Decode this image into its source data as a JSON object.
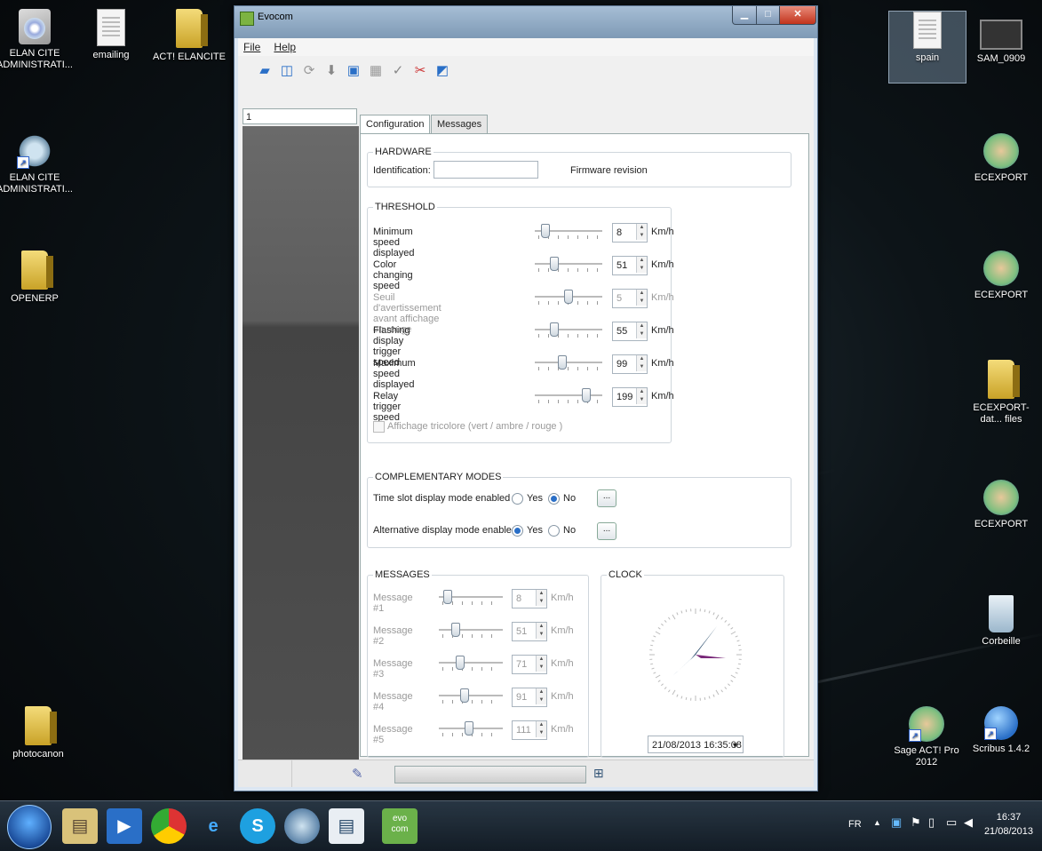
{
  "desktop": {
    "left_icons": [
      {
        "label": "ELAN CITE ADMINISTRATI...",
        "icon": "cd-icon"
      },
      {
        "label": "emailing",
        "icon": "document-icon"
      },
      {
        "label": "ACT! ELANCITE",
        "icon": "folder-icon"
      },
      {
        "label": "ELAN CITE ADMINISTRATI...",
        "icon": "gear-icon"
      },
      {
        "label": "OPENERP",
        "icon": "folder-icon"
      },
      {
        "label": "photocanon",
        "icon": "folder-icon"
      }
    ],
    "right_icons": [
      {
        "label": "spain",
        "icon": "document-icon"
      },
      {
        "label": "SAM_0909",
        "icon": "camera-icon"
      },
      {
        "label": "ECEXPORT",
        "icon": "handshake-icon"
      },
      {
        "label": "ECEXPORT",
        "icon": "handshake-icon"
      },
      {
        "label": "ECEXPORT-dat... files",
        "icon": "folder-icon"
      },
      {
        "label": "ECEXPORT",
        "icon": "handshake-icon"
      },
      {
        "label": "Corbeille",
        "icon": "recycle-bin-icon"
      },
      {
        "label": "Sage ACT! Pro 2012",
        "icon": "handshake-icon"
      },
      {
        "label": "Scribus 1.4.2",
        "icon": "scribus-icon"
      }
    ]
  },
  "window": {
    "title": "Evocom",
    "menu": [
      "File",
      "Help"
    ],
    "left_input_value": "1",
    "tabs": [
      "Configuration",
      "Messages"
    ],
    "hardware": {
      "legend": "HARDWARE",
      "identification_label": "Identification:",
      "identification_value": "",
      "firmware_label": "Firmware revision"
    },
    "threshold": {
      "legend": "THRESHOLD",
      "rows": [
        {
          "label": "Minimum speed displayed",
          "value": "8",
          "unit": "Km/h",
          "level": 0.1,
          "enabled": true
        },
        {
          "label": "Color changing speed",
          "value": "51",
          "unit": "Km/h",
          "level": 0.25,
          "enabled": true
        },
        {
          "label": "Seuil d'avertissement avant affichage en rouge",
          "value": "5",
          "unit": "Km/h",
          "level": 0.5,
          "enabled": false
        },
        {
          "label": "Flashing display trigger speed",
          "value": "55",
          "unit": "Km/h",
          "level": 0.25,
          "enabled": true
        },
        {
          "label": "Maximum speed displayed",
          "value": "99",
          "unit": "Km/h",
          "level": 0.4,
          "enabled": true
        },
        {
          "label": "Relay trigger speed",
          "value": "199",
          "unit": "Km/h",
          "level": 0.8,
          "enabled": true
        }
      ],
      "tricolor_label": "Affichage tricolore (vert / ambre / rouge )"
    },
    "complementary": {
      "legend": "COMPLEMENTARY MODES",
      "time_slot_label": "Time slot display mode enabled",
      "alt_label": "Alternative display mode enable",
      "yes": "Yes",
      "no": "No",
      "more": "...",
      "time_slot_selected": "No",
      "alt_selected": "Yes"
    },
    "messages": {
      "legend": "MESSAGES",
      "rows": [
        {
          "label": "Message #1",
          "value": "8",
          "unit": "Km/h",
          "level": 0.08
        },
        {
          "label": "Message #2",
          "value": "51",
          "unit": "Km/h",
          "level": 0.22
        },
        {
          "label": "Message #3",
          "value": "71",
          "unit": "Km/h",
          "level": 0.3
        },
        {
          "label": "Message #4",
          "value": "91",
          "unit": "Km/h",
          "level": 0.38
        },
        {
          "label": "Message #5",
          "value": "111",
          "unit": "Km/h",
          "level": 0.46
        }
      ]
    },
    "clock": {
      "legend": "CLOCK",
      "datetime": "21/08/2013 16:35:08"
    }
  },
  "taskbar": {
    "language": "FR",
    "time": "16:37",
    "date": "21/08/2013",
    "apps": [
      "explorer-icon",
      "media-player-icon",
      "chrome-icon",
      "internet-explorer-icon",
      "skype-icon",
      "network-icon",
      "document-icon",
      "evocom-icon"
    ]
  }
}
